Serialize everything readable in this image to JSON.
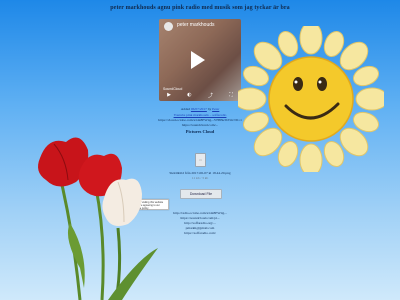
{
  "page": {
    "title": "peter markhouds agnu pink radio med musik som jag tyckar är bra"
  },
  "player": {
    "title": "peter markhouds",
    "source": "SoundCloud",
    "controls": [
      "Play",
      "Volume",
      "Share",
      "Fullscreen"
    ]
  },
  "info": {
    "line1_prefix": "Added",
    "line1_link": "06/07/2017",
    "line1_by": "by",
    "line1_author": "Peter",
    "line2": "Youtube pink markhouds – soffaradio",
    "line3": "https://cloud.octobe.com/s/t4x8EW4g...VH85k3bVm/?dl=1",
    "line4": "https://soundcloud.com/..."
  },
  "section": {
    "heading": "Pictures Cloud"
  },
  "file": {
    "thumbnail_label": "□",
    "name": "Skärmbild från 2017-06-07 kl 18.44.20.png",
    "size": "11 kb / 3 kb",
    "download_label": "Download File"
  },
  "tooltip": {
    "text": "By the visiting this website you are agreeing to our cookie policy."
  },
  "links": [
    "http://radio.octobe.com/s/t4x8EW4g...",
    "https://soundcloud.com/pi...",
    "http://soffaradio.org/...",
    "pmarkh@gmail.com",
    "https://soffaradio.com/"
  ]
}
